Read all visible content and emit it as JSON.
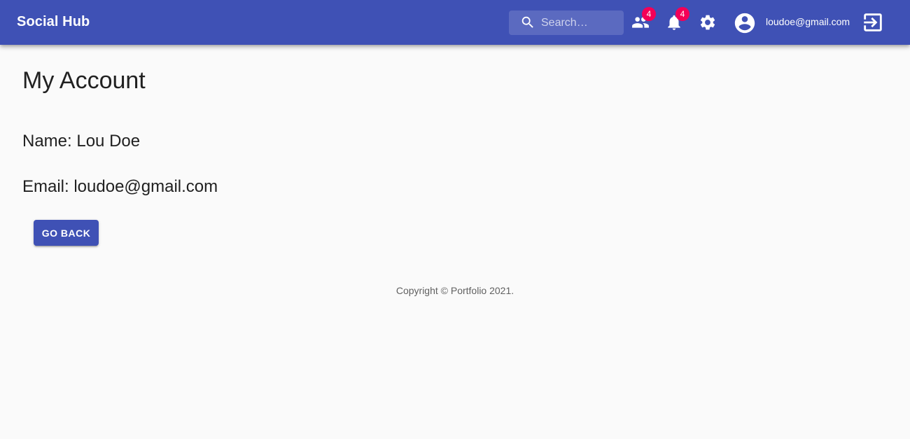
{
  "appbar": {
    "brand": "Social Hub",
    "search": {
      "placeholder": "Search…"
    },
    "friends_badge": "4",
    "notifications_badge": "4",
    "user_email": "loudoe@gmail.com",
    "icons": [
      "search-icon",
      "people-icon",
      "bell-icon",
      "gear-icon",
      "account-circle-icon",
      "logout-icon"
    ]
  },
  "main": {
    "title": "My Account",
    "name_line": "Name: Lou Doe",
    "email_line": "Email: loudoe@gmail.com",
    "go_back_label": "Go back"
  },
  "footer": {
    "text": "Copyright © Portfolio 2021."
  },
  "colors": {
    "primary": "#3f51b5",
    "badge": "#f50057",
    "background": "#fafafa"
  }
}
